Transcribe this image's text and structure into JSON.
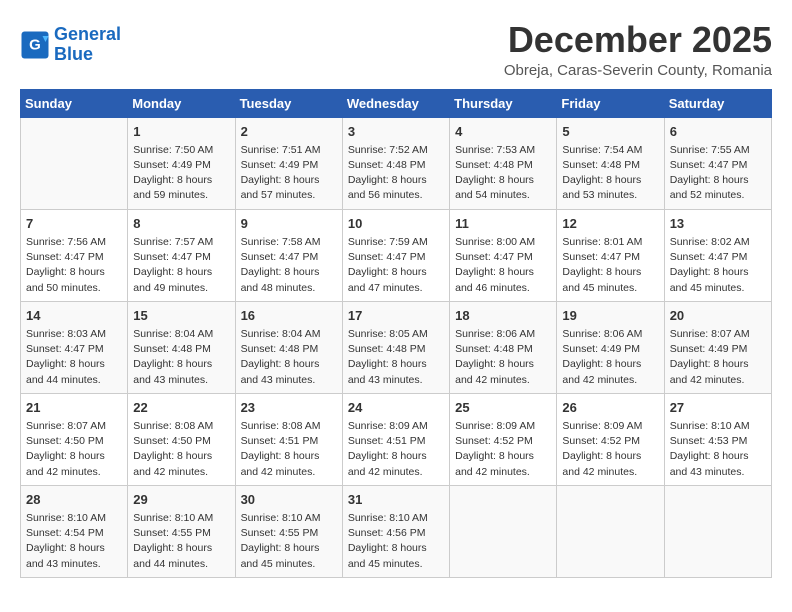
{
  "header": {
    "logo_line1": "General",
    "logo_line2": "Blue",
    "month": "December 2025",
    "location": "Obreja, Caras-Severin County, Romania"
  },
  "days_of_week": [
    "Sunday",
    "Monday",
    "Tuesday",
    "Wednesday",
    "Thursday",
    "Friday",
    "Saturday"
  ],
  "weeks": [
    [
      {
        "day": "",
        "info": ""
      },
      {
        "day": "1",
        "info": "Sunrise: 7:50 AM\nSunset: 4:49 PM\nDaylight: 8 hours\nand 59 minutes."
      },
      {
        "day": "2",
        "info": "Sunrise: 7:51 AM\nSunset: 4:49 PM\nDaylight: 8 hours\nand 57 minutes."
      },
      {
        "day": "3",
        "info": "Sunrise: 7:52 AM\nSunset: 4:48 PM\nDaylight: 8 hours\nand 56 minutes."
      },
      {
        "day": "4",
        "info": "Sunrise: 7:53 AM\nSunset: 4:48 PM\nDaylight: 8 hours\nand 54 minutes."
      },
      {
        "day": "5",
        "info": "Sunrise: 7:54 AM\nSunset: 4:48 PM\nDaylight: 8 hours\nand 53 minutes."
      },
      {
        "day": "6",
        "info": "Sunrise: 7:55 AM\nSunset: 4:47 PM\nDaylight: 8 hours\nand 52 minutes."
      }
    ],
    [
      {
        "day": "7",
        "info": "Sunrise: 7:56 AM\nSunset: 4:47 PM\nDaylight: 8 hours\nand 50 minutes."
      },
      {
        "day": "8",
        "info": "Sunrise: 7:57 AM\nSunset: 4:47 PM\nDaylight: 8 hours\nand 49 minutes."
      },
      {
        "day": "9",
        "info": "Sunrise: 7:58 AM\nSunset: 4:47 PM\nDaylight: 8 hours\nand 48 minutes."
      },
      {
        "day": "10",
        "info": "Sunrise: 7:59 AM\nSunset: 4:47 PM\nDaylight: 8 hours\nand 47 minutes."
      },
      {
        "day": "11",
        "info": "Sunrise: 8:00 AM\nSunset: 4:47 PM\nDaylight: 8 hours\nand 46 minutes."
      },
      {
        "day": "12",
        "info": "Sunrise: 8:01 AM\nSunset: 4:47 PM\nDaylight: 8 hours\nand 45 minutes."
      },
      {
        "day": "13",
        "info": "Sunrise: 8:02 AM\nSunset: 4:47 PM\nDaylight: 8 hours\nand 45 minutes."
      }
    ],
    [
      {
        "day": "14",
        "info": "Sunrise: 8:03 AM\nSunset: 4:47 PM\nDaylight: 8 hours\nand 44 minutes."
      },
      {
        "day": "15",
        "info": "Sunrise: 8:04 AM\nSunset: 4:48 PM\nDaylight: 8 hours\nand 43 minutes."
      },
      {
        "day": "16",
        "info": "Sunrise: 8:04 AM\nSunset: 4:48 PM\nDaylight: 8 hours\nand 43 minutes."
      },
      {
        "day": "17",
        "info": "Sunrise: 8:05 AM\nSunset: 4:48 PM\nDaylight: 8 hours\nand 43 minutes."
      },
      {
        "day": "18",
        "info": "Sunrise: 8:06 AM\nSunset: 4:48 PM\nDaylight: 8 hours\nand 42 minutes."
      },
      {
        "day": "19",
        "info": "Sunrise: 8:06 AM\nSunset: 4:49 PM\nDaylight: 8 hours\nand 42 minutes."
      },
      {
        "day": "20",
        "info": "Sunrise: 8:07 AM\nSunset: 4:49 PM\nDaylight: 8 hours\nand 42 minutes."
      }
    ],
    [
      {
        "day": "21",
        "info": "Sunrise: 8:07 AM\nSunset: 4:50 PM\nDaylight: 8 hours\nand 42 minutes."
      },
      {
        "day": "22",
        "info": "Sunrise: 8:08 AM\nSunset: 4:50 PM\nDaylight: 8 hours\nand 42 minutes."
      },
      {
        "day": "23",
        "info": "Sunrise: 8:08 AM\nSunset: 4:51 PM\nDaylight: 8 hours\nand 42 minutes."
      },
      {
        "day": "24",
        "info": "Sunrise: 8:09 AM\nSunset: 4:51 PM\nDaylight: 8 hours\nand 42 minutes."
      },
      {
        "day": "25",
        "info": "Sunrise: 8:09 AM\nSunset: 4:52 PM\nDaylight: 8 hours\nand 42 minutes."
      },
      {
        "day": "26",
        "info": "Sunrise: 8:09 AM\nSunset: 4:52 PM\nDaylight: 8 hours\nand 42 minutes."
      },
      {
        "day": "27",
        "info": "Sunrise: 8:10 AM\nSunset: 4:53 PM\nDaylight: 8 hours\nand 43 minutes."
      }
    ],
    [
      {
        "day": "28",
        "info": "Sunrise: 8:10 AM\nSunset: 4:54 PM\nDaylight: 8 hours\nand 43 minutes."
      },
      {
        "day": "29",
        "info": "Sunrise: 8:10 AM\nSunset: 4:55 PM\nDaylight: 8 hours\nand 44 minutes."
      },
      {
        "day": "30",
        "info": "Sunrise: 8:10 AM\nSunset: 4:55 PM\nDaylight: 8 hours\nand 45 minutes."
      },
      {
        "day": "31",
        "info": "Sunrise: 8:10 AM\nSunset: 4:56 PM\nDaylight: 8 hours\nand 45 minutes."
      },
      {
        "day": "",
        "info": ""
      },
      {
        "day": "",
        "info": ""
      },
      {
        "day": "",
        "info": ""
      }
    ]
  ]
}
